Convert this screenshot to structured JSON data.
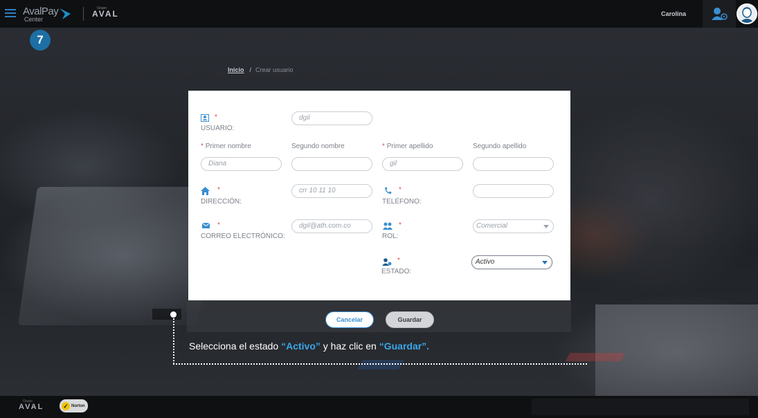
{
  "header": {
    "logo_primary": "AvalPay",
    "logo_secondary": "Center",
    "group_small": "Grupo",
    "group_logo": "AVAL",
    "username": "Carolina"
  },
  "step_number": "7",
  "breadcrumb": {
    "home": "Inicio",
    "separator": "/",
    "current": "Crear usuario"
  },
  "form": {
    "usuario": {
      "label": "USUARIO:",
      "value": "dgil"
    },
    "primer_nombre": {
      "label": "Primer nombre",
      "value": "Diana"
    },
    "segundo_nombre": {
      "label": "Segundo nombre",
      "value": ""
    },
    "primer_apellido": {
      "label": "Primer apellido",
      "value": "gil"
    },
    "segundo_apellido": {
      "label": "Segundo apellido",
      "value": ""
    },
    "direccion": {
      "label": "DIRECCIÓN:",
      "value": "crr 10 11 10"
    },
    "telefono": {
      "label": "TELÉFONO:",
      "value": ""
    },
    "correo": {
      "label": "CORREO ELECTRÓNICO:",
      "value": "dgil@ath.com.co"
    },
    "rol": {
      "label": "ROL:",
      "value": "Comercial"
    },
    "estado": {
      "label": "ESTADO:",
      "value": "Activo"
    },
    "required_mark": "*"
  },
  "buttons": {
    "cancel": "Cancelar",
    "save": "Guardar"
  },
  "instruction": {
    "part1": "Selecciona el estado ",
    "highlight1": "“Activo”",
    "part2": " y haz clic en ",
    "highlight2": "“Guardar”."
  },
  "footer": {
    "group_small": "Grupo",
    "group_logo": "AVAL",
    "norton_label": "Norton"
  },
  "colors": {
    "accent": "#3aa7e8",
    "brand_blue": "#1d6fa5",
    "required": "#e04b4b"
  }
}
